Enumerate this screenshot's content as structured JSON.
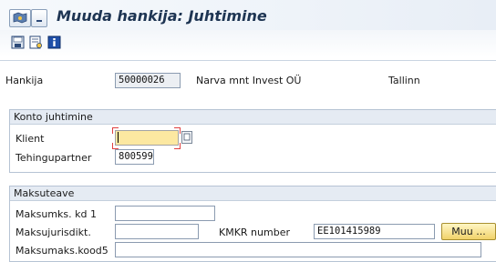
{
  "title": "Muuda hankija: Juhtimine",
  "toolbar": [
    {
      "icon": "save-icon"
    },
    {
      "icon": "display-icon"
    },
    {
      "icon": "info-icon"
    }
  ],
  "header": {
    "vendor_label": "Hankija",
    "vendor_number": "50000026",
    "vendor_name": "Narva mnt Invest OÜ",
    "vendor_city": "Tallinn"
  },
  "account_control": {
    "title": "Konto juhtimine",
    "client_label": "Klient",
    "client_value": "",
    "trading_partner_label": "Tehingupartner",
    "trading_partner_value": "800599"
  },
  "tax_info": {
    "title": "Maksuteave",
    "tax_code1_label": "Maksumks. kd 1",
    "tax_code1_value": "",
    "tax_jurisdiction_label": "Maksujurisdikt.",
    "tax_jurisdiction_value": "",
    "vat_label": "KMKR number",
    "vat_value": "EE101415989",
    "more_button": "Muu ...",
    "tax_code5_label": "Maksumaks.kood5",
    "tax_code5_value": ""
  }
}
